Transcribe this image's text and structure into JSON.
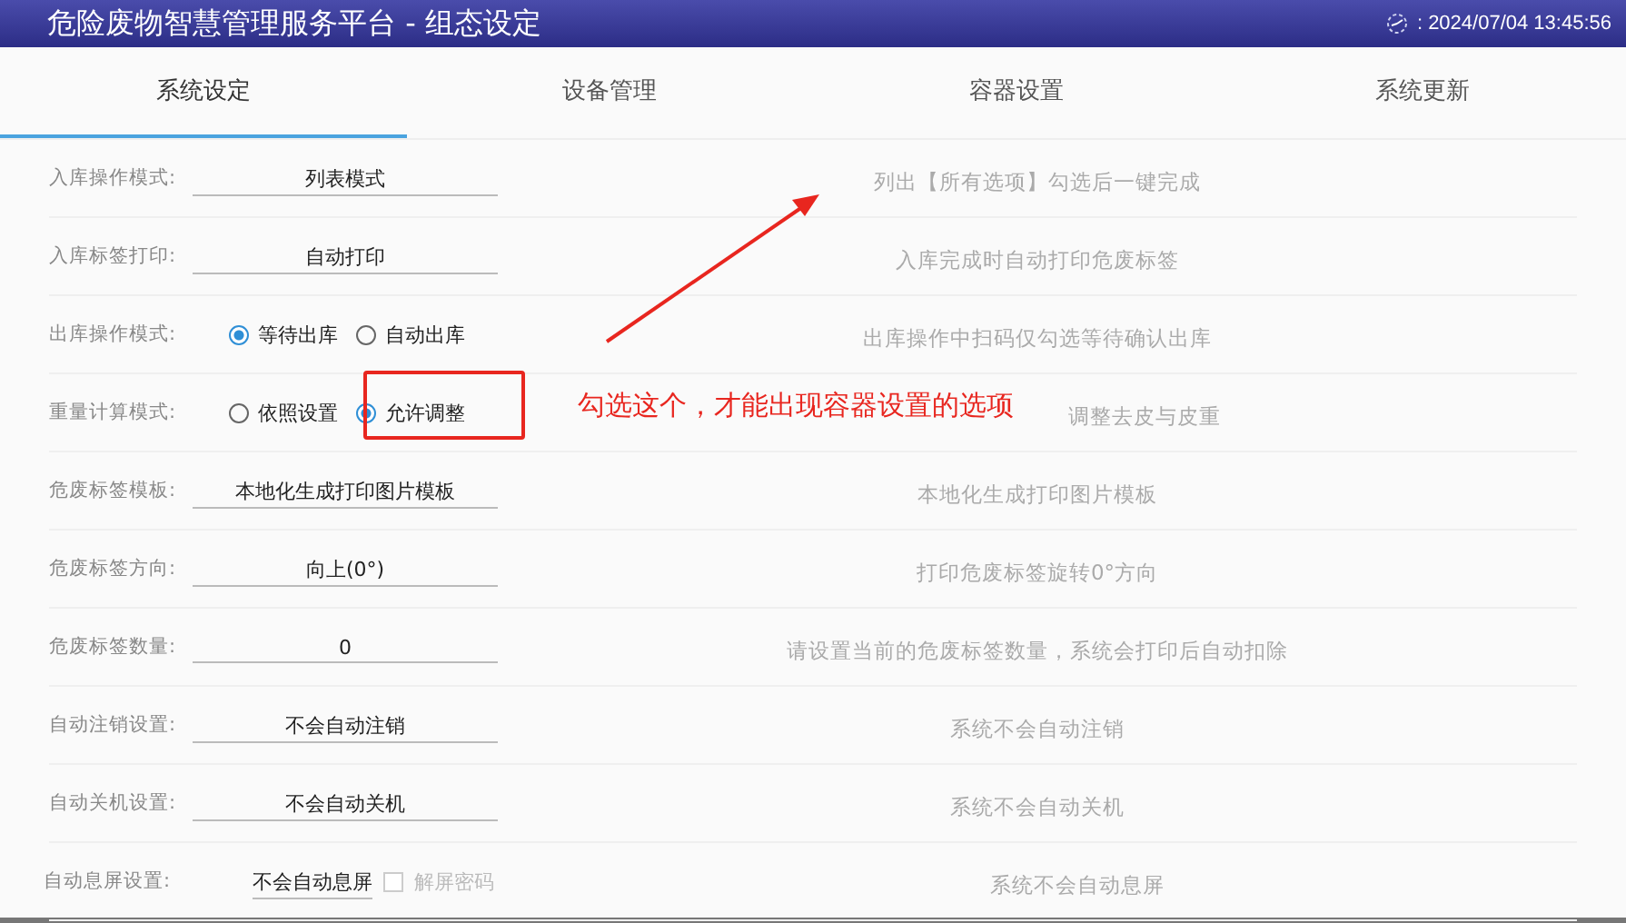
{
  "window": {
    "title": "危险废物智慧管理服务平台 - 组态设定",
    "datetime": ": 2024/07/04 13:45:56"
  },
  "tabs": [
    {
      "label": "系统设定",
      "selected": true
    },
    {
      "label": "设备管理",
      "selected": false
    },
    {
      "label": "容器设置",
      "selected": false
    },
    {
      "label": "系统更新",
      "selected": false
    }
  ],
  "settings": [
    {
      "kind": "field",
      "label": "入库操作模式:",
      "value": "列表模式",
      "description": "列出【所有选项】勾选后一键完成"
    },
    {
      "kind": "field",
      "label": "入库标签打印:",
      "value": "自动打印",
      "description": "入库完成时自动打印危废标签"
    },
    {
      "kind": "radio",
      "label": "出库操作模式:",
      "options": [
        {
          "label": "等待出库",
          "selected": true
        },
        {
          "label": "自动出库",
          "selected": false
        }
      ],
      "description": "出库操作中扫码仅勾选等待确认出库"
    },
    {
      "kind": "radio",
      "label": "重量计算模式:",
      "options": [
        {
          "label": "依照设置",
          "selected": false
        },
        {
          "label": "允许调整",
          "selected": true
        }
      ],
      "description": "调整去皮与皮重"
    },
    {
      "kind": "field",
      "label": "危废标签模板:",
      "value": "本地化生成打印图片模板",
      "description": "本地化生成打印图片模板"
    },
    {
      "kind": "field",
      "label": "危废标签方向:",
      "value": "向上(0°)",
      "description": "打印危废标签旋转0°方向"
    },
    {
      "kind": "field",
      "label": "危废标签数量:",
      "value": "0",
      "description": "请设置当前的危废标签数量，系统会打印后自动扣除"
    },
    {
      "kind": "field",
      "label": "自动注销设置:",
      "value": "不会自动注销",
      "description": "系统不会自动注销"
    },
    {
      "kind": "field",
      "label": "自动关机设置:",
      "value": "不会自动关机",
      "description": "系统不会自动关机"
    },
    {
      "kind": "field_checkbox",
      "label": "自动息屏设置:",
      "value": "不会自动息屏",
      "checkbox": {
        "label": "解屏密码",
        "checked": false,
        "disabled": true
      },
      "description": "系统不会自动息屏"
    }
  ],
  "annotation": {
    "text": "勾选这个，才能出现容器设置的选项"
  }
}
